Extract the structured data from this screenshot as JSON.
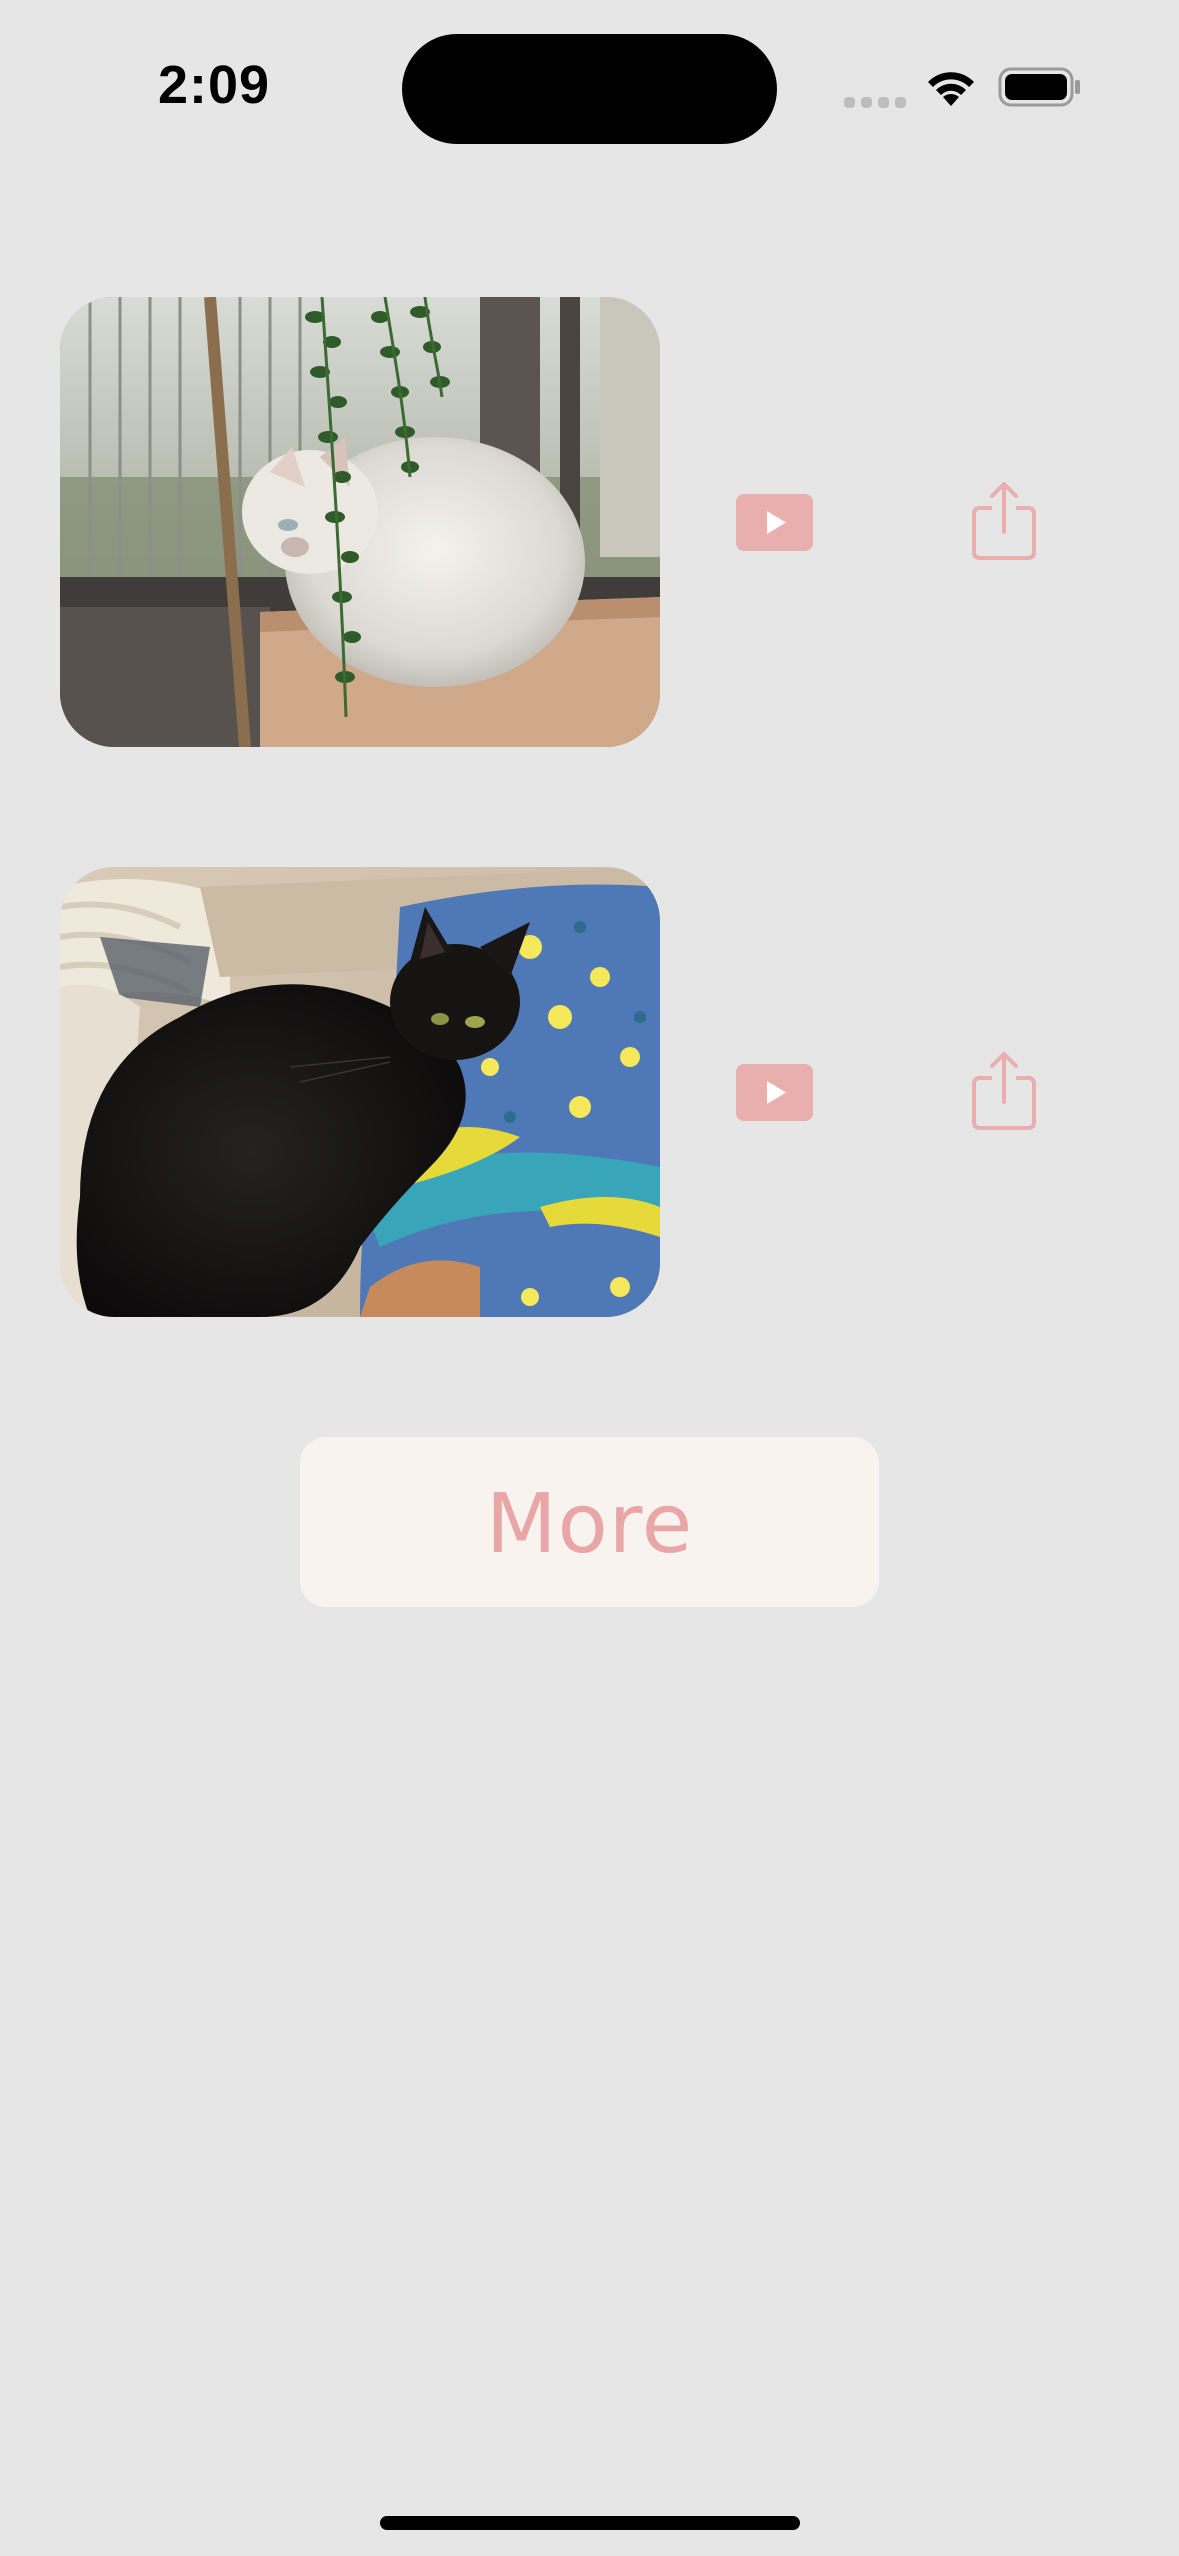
{
  "status_bar": {
    "time": "2:09",
    "icons": [
      "cellular-signal-icon",
      "wifi-icon",
      "battery-icon"
    ]
  },
  "items": [
    {
      "photo": "white-cat-photo",
      "actions": [
        "play-icon",
        "share-icon"
      ]
    },
    {
      "photo": "black-cat-photo",
      "actions": [
        "play-icon",
        "share-icon"
      ]
    }
  ],
  "more_button": {
    "label": "More"
  },
  "colors": {
    "background": "#e6e6e6",
    "accent": "#e9aeae",
    "more_button_bg": "#f8f3ef",
    "more_button_text": "#e8a6a6"
  }
}
